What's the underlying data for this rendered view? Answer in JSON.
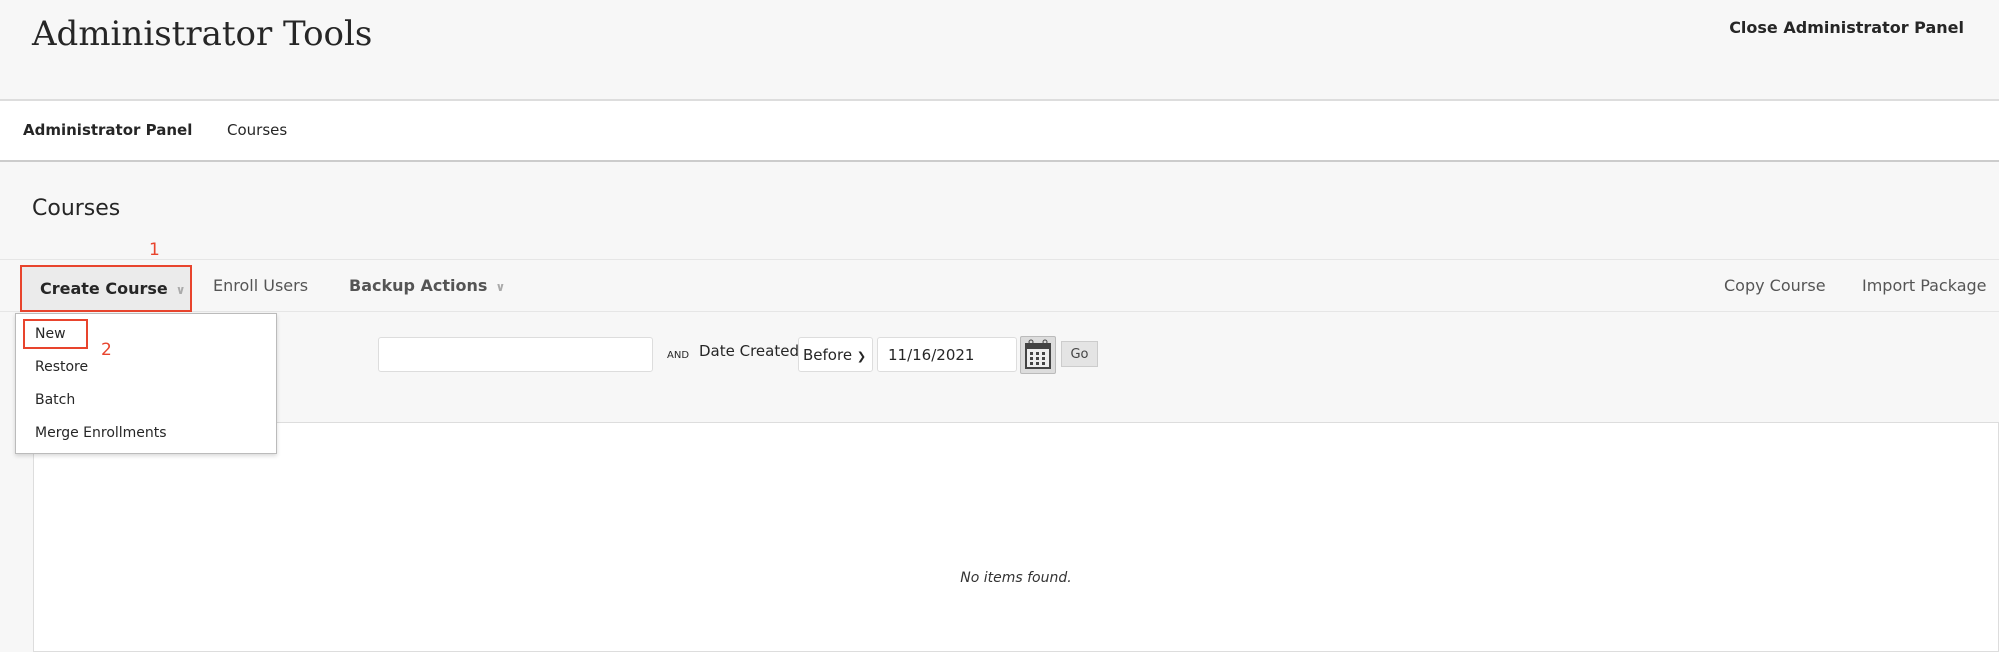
{
  "header": {
    "title": "Administrator Tools",
    "close_label": "Close Administrator Panel"
  },
  "breadcrumb": [
    "Administrator Panel",
    "Courses"
  ],
  "page_title": "Courses",
  "toolbar": {
    "create_course": "Create Course",
    "enroll_users": "Enroll Users",
    "backup_actions": "Backup Actions",
    "copy_course": "Copy Course",
    "import_package": "Import Package"
  },
  "annotations": {
    "step1": "1",
    "step2": "2",
    "color": "#e8442d"
  },
  "create_menu": [
    "New",
    "Restore",
    "Batch",
    "Merge Enrollments"
  ],
  "filter": {
    "search_value": "",
    "and_label": "AND",
    "date_label": "Date Created",
    "operator": "Before",
    "date_value": "11/16/2021",
    "go": "Go"
  },
  "table": {
    "empty_message": "No items found."
  }
}
